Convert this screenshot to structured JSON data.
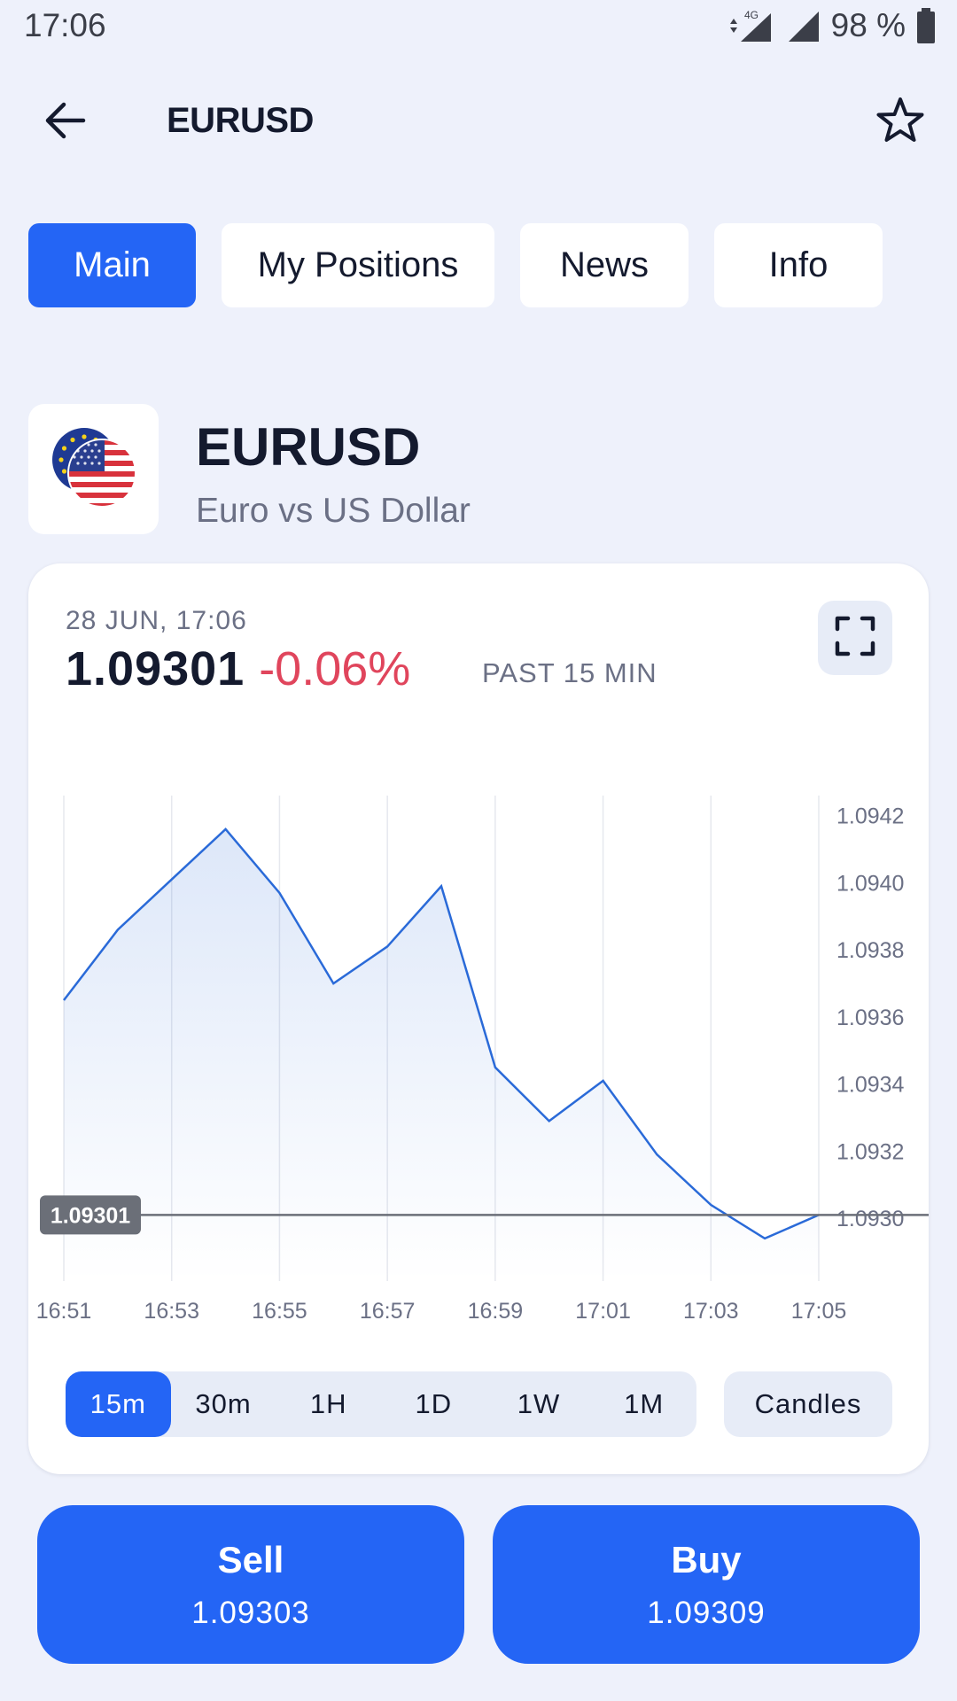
{
  "status_bar": {
    "time": "17:06",
    "network": "4G",
    "battery": "98 %"
  },
  "header": {
    "title": "EURUSD",
    "icons": [
      "back-arrow-icon",
      "star-outline-icon"
    ]
  },
  "tabs": [
    {
      "label": "Main",
      "active": true
    },
    {
      "label": "My Positions",
      "active": false
    },
    {
      "label": "News",
      "active": false
    },
    {
      "label": "Info",
      "active": false
    }
  ],
  "instrument": {
    "symbol": "EURUSD",
    "name": "Euro vs US Dollar",
    "icon": "eu-us-flags-icon"
  },
  "quote": {
    "date": "28 JUN, 17:06",
    "price": "1.09301",
    "change": "-0.06%",
    "period_label": "PAST 15 MIN"
  },
  "chart_data": {
    "type": "area",
    "x": [
      "16:51",
      "16:52",
      "16:53",
      "16:54",
      "16:55",
      "16:56",
      "16:57",
      "16:58",
      "16:59",
      "17:00",
      "17:01",
      "17:02",
      "17:03",
      "17:04",
      "17:05"
    ],
    "x_tick_labels": [
      "16:51",
      "16:53",
      "16:55",
      "16:57",
      "16:59",
      "17:01",
      "17:03",
      "17:05"
    ],
    "y": [
      1.09365,
      1.09386,
      1.09401,
      1.09416,
      1.09397,
      1.0937,
      1.09381,
      1.09399,
      1.09345,
      1.09329,
      1.09341,
      1.09319,
      1.09304,
      1.09294,
      1.09301
    ],
    "y_tick_labels": [
      "1.0942",
      "1.0940",
      "1.0938",
      "1.0936",
      "1.0934",
      "1.0932",
      "1.0930"
    ],
    "ylim": [
      1.09285,
      1.09426
    ],
    "current_price_line": 1.09301,
    "current_price_label": "1.09301",
    "grid": "vertical",
    "line_color": "#2a6ad8",
    "price_line_color": "#6b6f78"
  },
  "periods": [
    {
      "label": "15m",
      "active": true
    },
    {
      "label": "30m",
      "active": false
    },
    {
      "label": "1H",
      "active": false
    },
    {
      "label": "1D",
      "active": false
    },
    {
      "label": "1W",
      "active": false
    },
    {
      "label": "1M",
      "active": false
    }
  ],
  "chart_type_button": "Candles",
  "trade": {
    "sell_label": "Sell",
    "sell_price": "1.09303",
    "buy_label": "Buy",
    "buy_price": "1.09309"
  },
  "colors": {
    "accent": "#2465f5",
    "negative": "#e0455c",
    "background": "#eef1fb"
  }
}
